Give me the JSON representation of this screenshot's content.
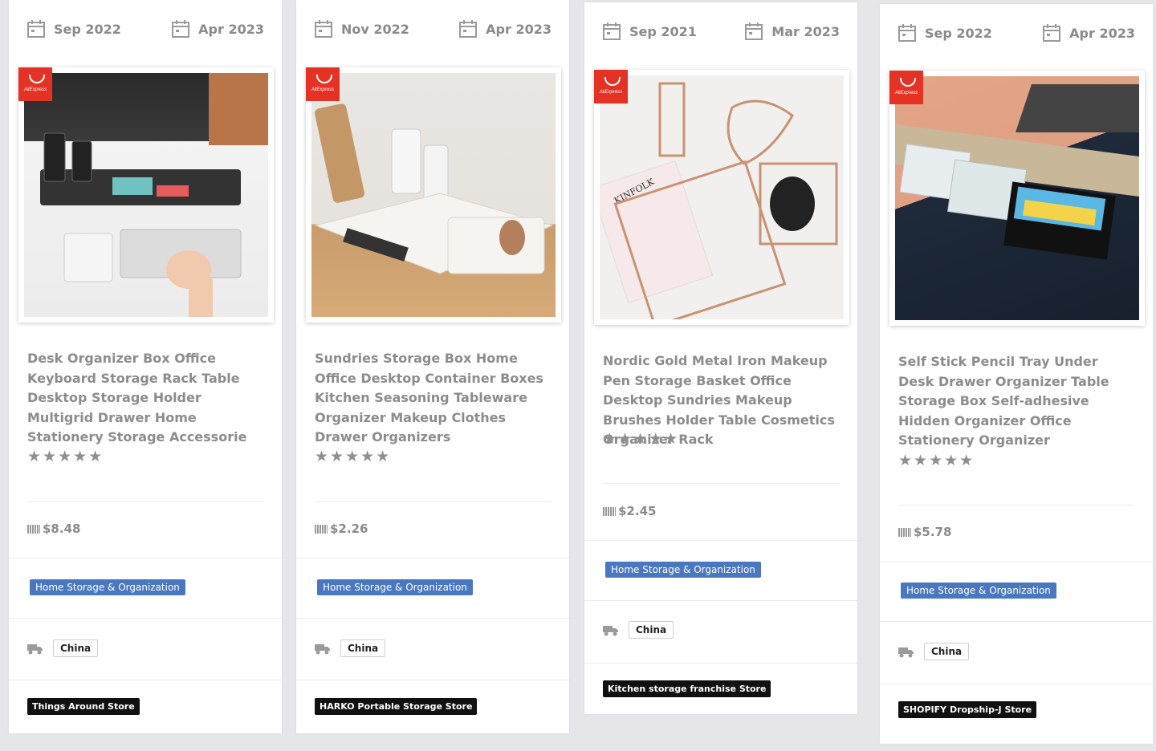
{
  "colors": {
    "category_badge": "#4a78c0",
    "store_badge": "#111111",
    "aliexpress_red": "#e43225",
    "text_gray": "#8c8c8c"
  },
  "cards": [
    {
      "date_start": "Sep 2022",
      "date_end": "Apr 2023",
      "source_logo": "AliExpress",
      "title": "Desk Organizer Box Office Keyboard Storage Rack Table Desktop Storage Holder Multigrid Drawer Home Stationery Storage Accessorie",
      "rating": "★★★★★",
      "price": "$8.48",
      "category": "Home Storage & Organization",
      "ship_from": "China",
      "store": "Things Around Store"
    },
    {
      "date_start": "Nov 2022",
      "date_end": "Apr 2023",
      "source_logo": "AliExpress",
      "title": "Sundries Storage Box Home Office Desktop Container Boxes Kitchen Seasoning Tableware Organizer Makeup Clothes Drawer Organizers",
      "rating": "★★★★★",
      "price": "$2.26",
      "category": "Home Storage & Organization",
      "ship_from": "China",
      "store": "HARKO Portable Storage Store"
    },
    {
      "date_start": "Sep 2021",
      "date_end": "Mar 2023",
      "source_logo": "AliExpress",
      "title": "Nordic Gold Metal Iron Makeup Pen Storage Basket Office Desktop Sundries Makeup Brushes Holder Table Cosmetics Organizer Rack",
      "rating": "★★★★★",
      "price": "$2.45",
      "category": "Home Storage & Organization",
      "ship_from": "China",
      "store": "Kitchen storage franchise Store",
      "image_text": "KINFOLK"
    },
    {
      "date_start": "Sep 2022",
      "date_end": "Apr 2023",
      "source_logo": "AliExpress",
      "title": "Self Stick Pencil Tray Under Desk Drawer Organizer Table Storage Box Self-adhesive Hidden Organizer Office Stationery Organizer",
      "rating": "★★★★★",
      "price": "$5.78",
      "category": "Home Storage & Organization",
      "ship_from": "China",
      "store": "SHOPIFY Dropship-J Store"
    }
  ]
}
